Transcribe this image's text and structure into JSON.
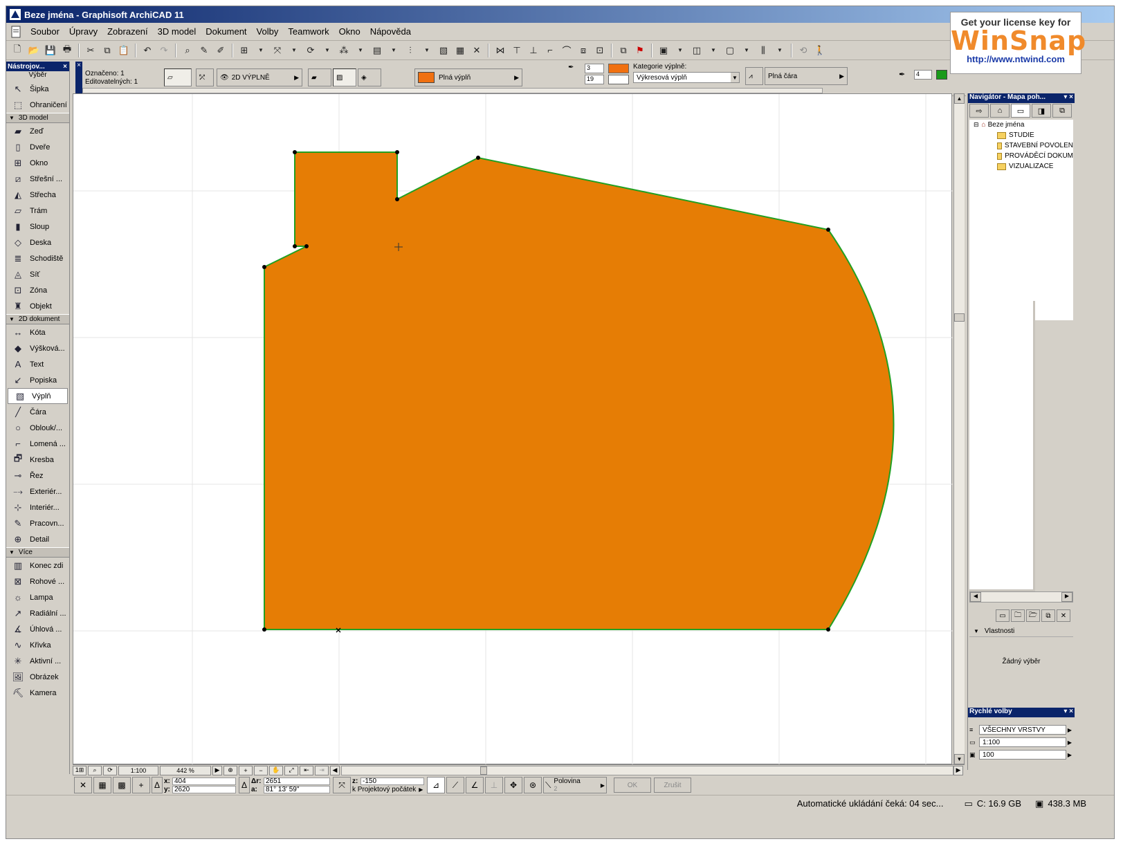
{
  "window": {
    "title": "Beze jména - Graphisoft ArchiCAD 11"
  },
  "menubar": [
    "Soubor",
    "Úpravy",
    "Zobrazení",
    "3D model",
    "Dokument",
    "Volby",
    "Teamwork",
    "Okno",
    "Nápověda"
  ],
  "watermark": {
    "line1": "Get your license key for",
    "logo": "WinSnap",
    "url": "http://www.ntwind.com"
  },
  "infobox": {
    "marked_label": "Označeno: 1",
    "editable_label": "Editovatelných: 1",
    "layer_mode": "2D VÝPLNĚ",
    "fill_type": "Plná výplň",
    "pen_top": "3",
    "pen_bottom": "19",
    "category_label": "Kategorie výplně:",
    "category_value": "Výkresová výplň",
    "line_type": "Plná čára",
    "pen_right": "4"
  },
  "toolbox": {
    "title": "Nástrojov...",
    "select_label": "Výběr",
    "sections": [
      {
        "name": "",
        "tools": [
          {
            "label": "Šipka",
            "icon": "arrow-icon"
          },
          {
            "label": "Ohraničení",
            "icon": "marquee-icon"
          }
        ]
      },
      {
        "name": "3D model",
        "tools": [
          {
            "label": "Zeď",
            "icon": "wall-icon"
          },
          {
            "label": "Dveře",
            "icon": "door-icon"
          },
          {
            "label": "Okno",
            "icon": "window-icon"
          },
          {
            "label": "Střešní ...",
            "icon": "roof-window-icon"
          },
          {
            "label": "Střecha",
            "icon": "roof-icon"
          },
          {
            "label": "Trám",
            "icon": "beam-icon"
          },
          {
            "label": "Sloup",
            "icon": "column-icon"
          },
          {
            "label": "Deska",
            "icon": "slab-icon"
          },
          {
            "label": "Schodiště",
            "icon": "stair-icon"
          },
          {
            "label": "Síť",
            "icon": "mesh-icon"
          },
          {
            "label": "Zóna",
            "icon": "zone-icon"
          },
          {
            "label": "Objekt",
            "icon": "object-icon"
          }
        ]
      },
      {
        "name": "2D dokument",
        "tools": [
          {
            "label": "Kóta",
            "icon": "dimension-icon"
          },
          {
            "label": "Výšková...",
            "icon": "level-icon"
          },
          {
            "label": "Text",
            "icon": "text-icon"
          },
          {
            "label": "Popiska",
            "icon": "label-icon"
          },
          {
            "label": "Výplň",
            "icon": "fill-icon",
            "active": true
          },
          {
            "label": "Čára",
            "icon": "line-icon"
          },
          {
            "label": "Oblouk/...",
            "icon": "arc-icon"
          },
          {
            "label": "Lomená ...",
            "icon": "polyline-icon"
          },
          {
            "label": "Kresba",
            "icon": "drawing-icon"
          },
          {
            "label": "Řez",
            "icon": "section-icon"
          },
          {
            "label": "Exteriér...",
            "icon": "elevation-icon"
          },
          {
            "label": "Interiér...",
            "icon": "interior-icon"
          },
          {
            "label": "Pracovn...",
            "icon": "worksheet-icon"
          },
          {
            "label": "Detail",
            "icon": "detail-icon"
          }
        ]
      },
      {
        "name": "Více",
        "tools": [
          {
            "label": "Konec zdi",
            "icon": "wall-end-icon"
          },
          {
            "label": "Rohové ...",
            "icon": "corner-window-icon"
          },
          {
            "label": "Lampa",
            "icon": "lamp-icon"
          },
          {
            "label": "Radiální ...",
            "icon": "radial-dim-icon"
          },
          {
            "label": "Úhlová ...",
            "icon": "angle-dim-icon"
          },
          {
            "label": "Křivka",
            "icon": "spline-icon"
          },
          {
            "label": "Aktivní ...",
            "icon": "hotspot-icon"
          },
          {
            "label": "Obrázek",
            "icon": "picture-icon"
          },
          {
            "label": "Kamera",
            "icon": "camera-icon"
          }
        ]
      }
    ]
  },
  "navigator": {
    "title": "Navigátor - Mapa poh...",
    "root": "Beze jména",
    "folders": [
      "STUDIE",
      "STAVEBNÍ POVOLEN",
      "PROVÁDĚCÍ DOKUM",
      "VIZUALIZACE"
    ],
    "properties_label": "Vlastnosti",
    "no_selection": "Žádný výběr"
  },
  "quick_options": {
    "title": "Rychlé volby",
    "rows": [
      {
        "icon": "layers-icon",
        "value": "VŠECHNY VRSTVY"
      },
      {
        "icon": "scale-icon",
        "value": "1:100"
      },
      {
        "icon": "pen-set-icon",
        "value": "100"
      }
    ]
  },
  "viewbar": {
    "scale": "1:100",
    "zoom": "442 %"
  },
  "coordbar": {
    "x": "404",
    "y": "2620",
    "dr": "2651",
    "a": "81° 13' 59\"",
    "z": "-150",
    "origin": "k Projektový počátek",
    "snap": "Polovina",
    "snap_num": "2",
    "ok": "OK",
    "cancel": "Zrušit"
  },
  "statusbar": {
    "autosave": "Automatické ukládání čeká: 04 sec...",
    "disk": "C: 16.9 GB",
    "ram": "438.3 MB"
  },
  "colors": {
    "fill": "#e67d05",
    "outline": "#22a022",
    "title_bar": "#0a246a"
  }
}
